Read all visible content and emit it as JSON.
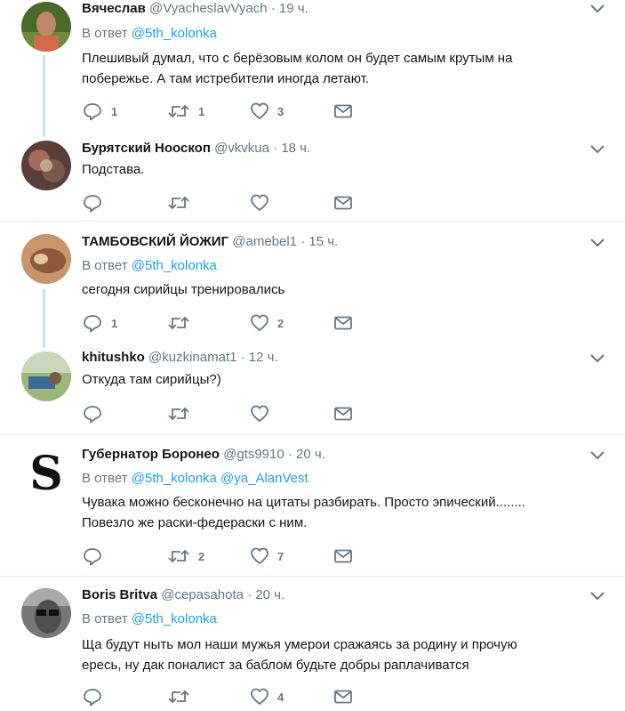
{
  "tweets": [
    {
      "name": "Вячеслав",
      "handle": "@VyacheslavVyach",
      "time": "19 ч.",
      "reply_prefix": "В ответ",
      "mentions": [
        "@5th_kolonka"
      ],
      "text_lines": [
        "Плешивый думал, что с берёзовым колом он будет самым крутым на",
        "побережье. А там истребители иногда летают."
      ],
      "replies": "1",
      "retweets": "1",
      "likes": "3"
    },
    {
      "name": "Бурятский Нооскоп",
      "handle": "@vkvkua",
      "time": "18 ч.",
      "reply_prefix": "",
      "mentions": [],
      "text_lines": [
        "Подстава."
      ],
      "replies": "",
      "retweets": "",
      "likes": ""
    },
    {
      "name": "ТАМБОВСКИЙ ЙОЖИГ",
      "handle": "@amebel1",
      "time": "15 ч.",
      "reply_prefix": "В ответ",
      "mentions": [
        "@5th_kolonka"
      ],
      "text_lines": [
        "сегодня сирийцы тренировались"
      ],
      "replies": "1",
      "retweets": "",
      "likes": "2"
    },
    {
      "name": "khitushko",
      "handle": "@kuzkinamat1",
      "time": "12 ч.",
      "reply_prefix": "",
      "mentions": [],
      "text_lines": [
        "Откуда там сирийцы?)"
      ],
      "replies": "",
      "retweets": "",
      "likes": ""
    },
    {
      "name": "Губернатор Боронео",
      "handle": "@gts9910",
      "time": "20 ч.",
      "reply_prefix": "В ответ",
      "mentions": [
        "@5th_kolonka",
        "@ya_AlanVest"
      ],
      "text_lines": [
        "Чувака можно бесконечно на цитаты разбирать. Просто эпический........",
        "Повезло же раски-федераски с ним."
      ],
      "replies": "",
      "retweets": "2",
      "likes": "7"
    },
    {
      "name": "Boris Britva",
      "handle": "@cepasahota",
      "time": "20 ч.",
      "reply_prefix": "В ответ",
      "mentions": [
        "@5th_kolonka"
      ],
      "text_lines": [
        "Ща будут ныть мол наши мужья умерои сражаясь за родину и прочую",
        "ересь,  ну дак поналист за баблом будьте добры раплачиватся"
      ],
      "replies": "",
      "retweets": "",
      "likes": "4"
    }
  ],
  "colors": {
    "link": "#1da1f2",
    "muted": "#657786",
    "text": "#14171a",
    "thread_line": "#c4e3f7",
    "separator": "#e6ecf0"
  },
  "icons": {
    "reply": "reply-icon",
    "retweet": "retweet-icon",
    "like": "heart-icon",
    "message": "envelope-icon",
    "menu": "chevron-down-icon"
  }
}
